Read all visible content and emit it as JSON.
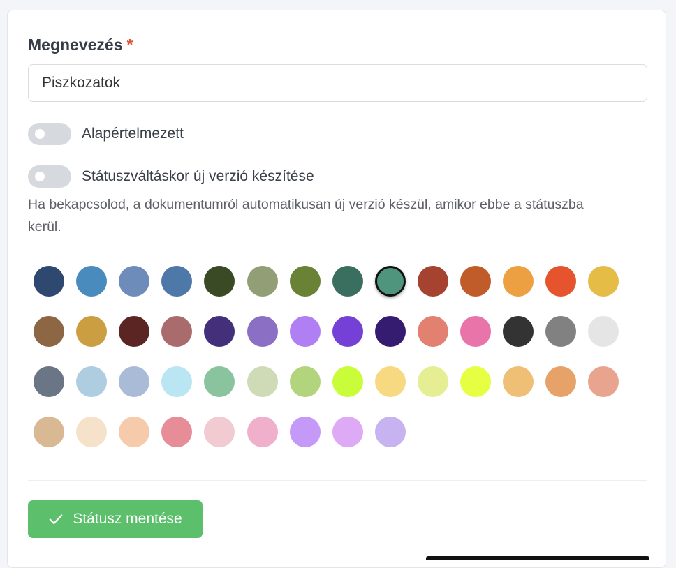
{
  "form": {
    "name_label": "Megnevezés",
    "required_mark": "*",
    "name_value": "Piszkozatok",
    "toggle_default_label": "Alapértelmezett",
    "toggle_default_on": false,
    "toggle_version_label": "Státuszváltáskor új verzió készítése",
    "toggle_version_on": false,
    "version_help": "Ha bekapcsolod, a dokumentumról automatikusan új verzió készül, amikor ebbe a státuszba kerül.",
    "save_label": "Státusz mentése"
  },
  "colors": {
    "selected_index": 8,
    "per_row": 14,
    "swatches": [
      "#2e4870",
      "#4a8bbd",
      "#6e8cba",
      "#4e78a8",
      "#3a4a25",
      "#929e76",
      "#6a8235",
      "#3a6e5e",
      "#4f957e",
      "#a64230",
      "#c05c2a",
      "#eda042",
      "#e5542c",
      "#e5bc46",
      "#8d6744",
      "#cc9e42",
      "#5b2524",
      "#aa6b6c",
      "#432f7a",
      "#8b6fc5",
      "#b17ff4",
      "#7440d6",
      "#361c70",
      "#e38170",
      "#e874a9",
      "#333333",
      "#818181",
      "#e5e5e5",
      "#6a7685",
      "#aecde0",
      "#a9bbd6",
      "#bae5f3",
      "#8ac49f",
      "#cfdab6",
      "#b2d47c",
      "#c9fd3a",
      "#f6d981",
      "#e5ee93",
      "#e6ff42",
      "#f0bf76",
      "#e6a268",
      "#e8a48f",
      "#d8b993",
      "#f6e2cb",
      "#f6cbab",
      "#e78d98",
      "#f2cad2",
      "#f0b0cb",
      "#c599f7",
      "#deaaf6",
      "#c6b3ef"
    ]
  }
}
